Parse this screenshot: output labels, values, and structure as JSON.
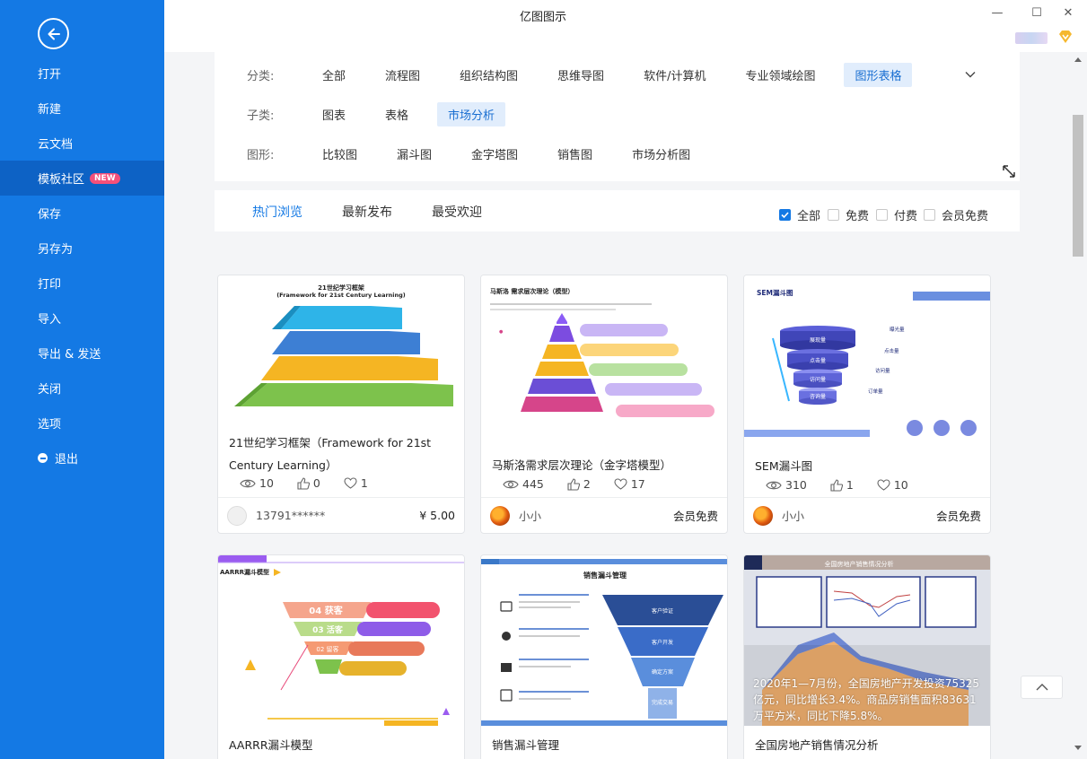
{
  "window": {
    "title": "亿图图示",
    "minimize": "—",
    "maximize": "☐",
    "close": "✕"
  },
  "sidebar": {
    "items": [
      {
        "label": "打开"
      },
      {
        "label": "新建"
      },
      {
        "label": "云文档"
      },
      {
        "label": "模板社区",
        "badge": "NEW",
        "active": true
      },
      {
        "label": "保存"
      },
      {
        "label": "另存为"
      },
      {
        "label": "打印"
      },
      {
        "label": "导入"
      },
      {
        "label": "导出 & 发送"
      },
      {
        "label": "关闭"
      },
      {
        "label": "选项"
      },
      {
        "label": "退出"
      }
    ]
  },
  "filter": {
    "category_label": "分类:",
    "categories": [
      "全部",
      "流程图",
      "组织结构图",
      "思维导图",
      "软件/计算机",
      "专业领域绘图",
      "图形表格"
    ],
    "category_selected": "图形表格",
    "subcategory_label": "子类:",
    "subcategories": [
      "图表",
      "表格",
      "市场分析"
    ],
    "subcategory_selected": "市场分析",
    "shape_label": "图形:",
    "shapes": [
      "比较图",
      "漏斗图",
      "金字塔图",
      "销售图",
      "市场分析图"
    ]
  },
  "sort": {
    "tabs": [
      "热门浏览",
      "最新发布",
      "最受欢迎"
    ],
    "selected": "热门浏览",
    "filters": [
      {
        "label": "全部",
        "checked": true
      },
      {
        "label": "免费",
        "checked": false
      },
      {
        "label": "付费",
        "checked": false
      },
      {
        "label": "会员免费",
        "checked": false
      }
    ]
  },
  "cards": [
    {
      "title": "21世纪学习框架（Framework for 21st Century Learning）",
      "thumb_title": "21世纪学习框架",
      "thumb_subtitle": "(Framework for 21st Century Learning)",
      "views": "10",
      "likes": "0",
      "favorites": "1",
      "author": "13791******",
      "price": "¥ 5.00"
    },
    {
      "title": "马斯洛需求层次理论（金字塔模型）",
      "thumb_title": "马斯洛 需求层次理论（模型）",
      "views": "445",
      "likes": "2",
      "favorites": "17",
      "author": "小小",
      "price": "会员免费"
    },
    {
      "title": "SEM漏斗图",
      "thumb_title": "SEM漏斗图",
      "thumb_levels": [
        "展现量",
        "点击量",
        "访问量",
        "咨询量"
      ],
      "thumb_side": [
        "曝光量",
        "点击量",
        "访问量",
        "订单量"
      ],
      "views": "310",
      "likes": "1",
      "favorites": "10",
      "author": "小小",
      "price": "会员免费"
    },
    {
      "title": "AARRR漏斗模型",
      "thumb_title": "AARRR漏斗模型",
      "thumb_levels": [
        "04 获客",
        "03 活客",
        "02 留客"
      ]
    },
    {
      "title": "销售漏斗管理",
      "thumb_title": "销售漏斗管理",
      "thumb_levels": [
        "客户验证",
        "客户开发",
        "确定方案",
        "完成交易"
      ]
    },
    {
      "title": "全国房地产销售情况分析",
      "thumb_title": "全国房地产销售情况分析",
      "overlay": "2020年1—7月份，全国房地产开发投资75325亿元，同比增长3.4%。商品房销售面积83631万平方米，同比下降5.8%。"
    }
  ],
  "colors": {
    "sidebar": "#1479e4",
    "sidebar_active": "#0d62c5",
    "accent": "#1479e4",
    "badge": "#f5507a"
  }
}
